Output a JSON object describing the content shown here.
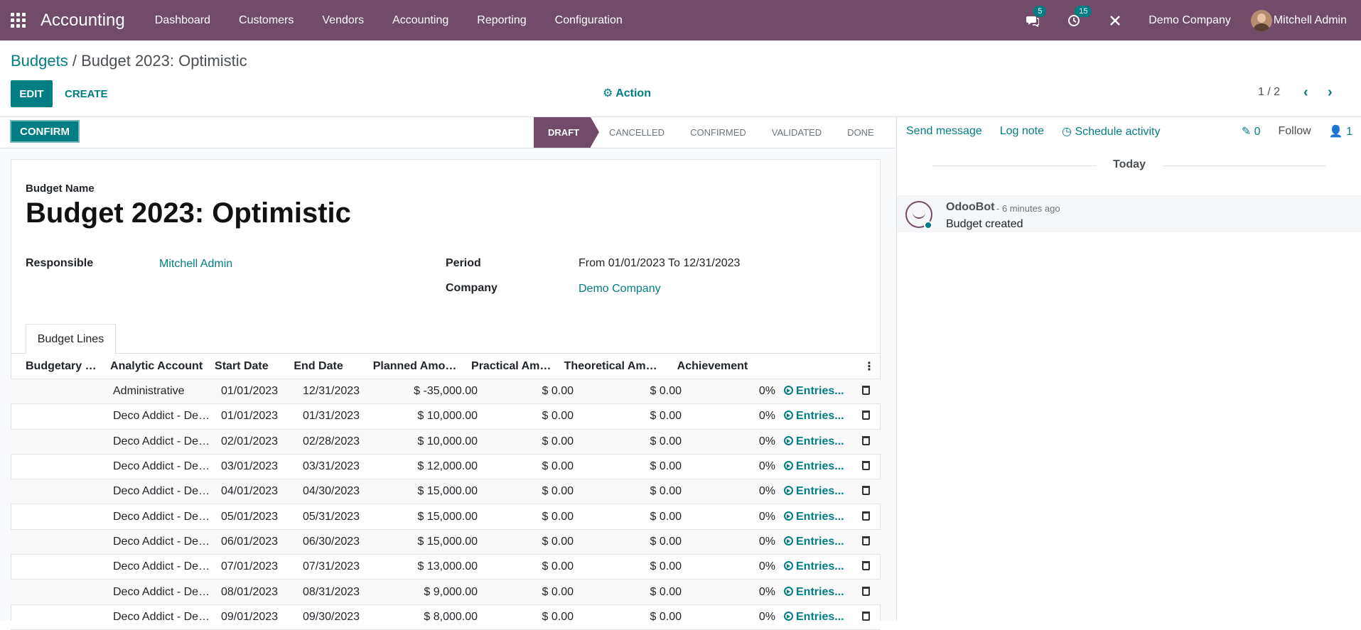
{
  "navbar": {
    "app_name": "Accounting",
    "menu": [
      "Dashboard",
      "Customers",
      "Vendors",
      "Accounting",
      "Reporting",
      "Configuration"
    ],
    "messages_count": "5",
    "activities_count": "15",
    "company": "Demo Company",
    "user": "Mitchell Admin"
  },
  "breadcrumb": {
    "parent": "Budgets",
    "separator": "/",
    "current": "Budget 2023: Optimistic"
  },
  "control": {
    "edit_label": "EDIT",
    "create_label": "CREATE",
    "action_label": "Action",
    "pager": "1 / 2"
  },
  "status": {
    "confirm_label": "CONFIRM",
    "stages": [
      "DRAFT",
      "CANCELLED",
      "CONFIRMED",
      "VALIDATED",
      "DONE"
    ],
    "active_stage": "DRAFT"
  },
  "form": {
    "name_label": "Budget Name",
    "name": "Budget 2023: Optimistic",
    "responsible_label": "Responsible",
    "responsible": "Mitchell Admin",
    "period_label": "Period",
    "period_from_label": "From",
    "period_from": "01/01/2023",
    "period_to_label": "To",
    "period_to": "12/31/2023",
    "company_label": "Company",
    "company": "Demo Company",
    "tab": "Budget Lines"
  },
  "table": {
    "headers": [
      "Budgetary Po...",
      "Analytic Account",
      "Start Date",
      "End Date",
      "Planned Amount",
      "Practical Amou...",
      "Theoretical Amou...",
      "Achievement"
    ],
    "entries_label": "Entries...",
    "rows": [
      {
        "account": "Administrative",
        "start": "01/01/2023",
        "end": "12/31/2023",
        "planned": "$ -35,000.00",
        "practical": "$ 0.00",
        "theoretical": "$ 0.00",
        "achievement": "0%"
      },
      {
        "account": "Deco Addict - Dec...",
        "start": "01/01/2023",
        "end": "01/31/2023",
        "planned": "$ 10,000.00",
        "practical": "$ 0.00",
        "theoretical": "$ 0.00",
        "achievement": "0%"
      },
      {
        "account": "Deco Addict - Dec...",
        "start": "02/01/2023",
        "end": "02/28/2023",
        "planned": "$ 10,000.00",
        "practical": "$ 0.00",
        "theoretical": "$ 0.00",
        "achievement": "0%"
      },
      {
        "account": "Deco Addict - Dec...",
        "start": "03/01/2023",
        "end": "03/31/2023",
        "planned": "$ 12,000.00",
        "practical": "$ 0.00",
        "theoretical": "$ 0.00",
        "achievement": "0%"
      },
      {
        "account": "Deco Addict - Dec...",
        "start": "04/01/2023",
        "end": "04/30/2023",
        "planned": "$ 15,000.00",
        "practical": "$ 0.00",
        "theoretical": "$ 0.00",
        "achievement": "0%"
      },
      {
        "account": "Deco Addict - Dec...",
        "start": "05/01/2023",
        "end": "05/31/2023",
        "planned": "$ 15,000.00",
        "practical": "$ 0.00",
        "theoretical": "$ 0.00",
        "achievement": "0%"
      },
      {
        "account": "Deco Addict - Dec...",
        "start": "06/01/2023",
        "end": "06/30/2023",
        "planned": "$ 15,000.00",
        "practical": "$ 0.00",
        "theoretical": "$ 0.00",
        "achievement": "0%"
      },
      {
        "account": "Deco Addict - Dec...",
        "start": "07/01/2023",
        "end": "07/31/2023",
        "planned": "$ 13,000.00",
        "practical": "$ 0.00",
        "theoretical": "$ 0.00",
        "achievement": "0%"
      },
      {
        "account": "Deco Addict - Dec...",
        "start": "08/01/2023",
        "end": "08/31/2023",
        "planned": "$ 9,000.00",
        "practical": "$ 0.00",
        "theoretical": "$ 0.00",
        "achievement": "0%"
      },
      {
        "account": "Deco Addict - Dec...",
        "start": "09/01/2023",
        "end": "09/30/2023",
        "planned": "$ 8,000.00",
        "practical": "$ 0.00",
        "theoretical": "$ 0.00",
        "achievement": "0%"
      }
    ]
  },
  "chatter": {
    "send_message": "Send message",
    "log_note": "Log note",
    "schedule_activity": "Schedule activity",
    "attachments_count": "0",
    "follow_label": "Follow",
    "followers_count": "1",
    "date_separator": "Today",
    "message": {
      "author": "OdooBot",
      "time": "- 6 minutes ago",
      "body": "Budget created"
    }
  }
}
